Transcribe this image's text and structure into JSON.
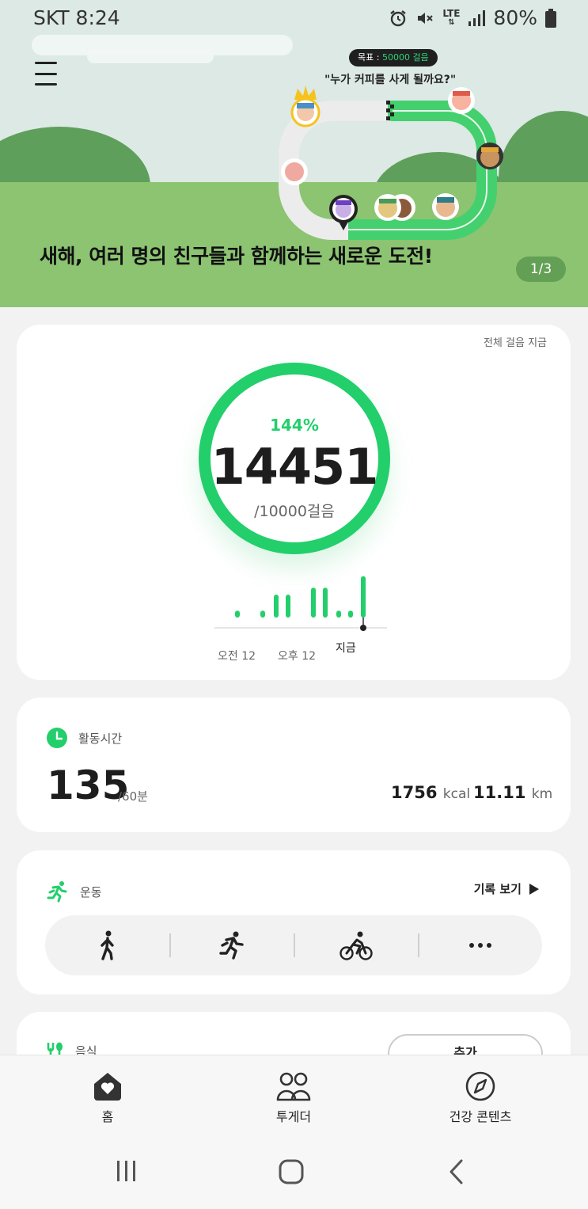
{
  "status_bar": {
    "carrier_time": "SKT 8:24",
    "network": "LTE",
    "battery": "80%"
  },
  "banner": {
    "goal_label": "목표 : ",
    "goal_value": "50000 걸음",
    "speech": "\"누가 커피를 사게 될까요?\"",
    "title": "새해, 여러 명의 친구들과 함께하는 새로운 도전!",
    "page_indicator": "1/3"
  },
  "steps": {
    "link": "전체 걸음 지금",
    "percent": "144%",
    "count": "14451",
    "goal": "/10000걸음",
    "chart": {
      "labels": [
        "오전 12",
        "오후 12",
        "지금"
      ],
      "bar_levels": [
        0.15,
        0.15,
        0.5,
        0.5,
        0.65,
        0.65,
        0.15,
        0.15,
        0.9
      ]
    }
  },
  "activity": {
    "label": "활동시간",
    "minutes": "135",
    "goal": "/60분",
    "kcal_value": "1756",
    "kcal_unit": "kcal",
    "km_value": "11.11",
    "km_unit": "km"
  },
  "exercise": {
    "label": "운동",
    "record_link": "기록 보기",
    "items": [
      "walk-icon",
      "run-icon",
      "bicycle-icon",
      "more-icon"
    ]
  },
  "food": {
    "label": "음식",
    "add_button": "추가"
  },
  "nav": {
    "home": "홈",
    "together": "투게더",
    "discover": "건강 콘텐츠"
  },
  "colors": {
    "accent": "#22cf6b",
    "grass": "#8cc472",
    "hill": "#5f9f5c"
  }
}
